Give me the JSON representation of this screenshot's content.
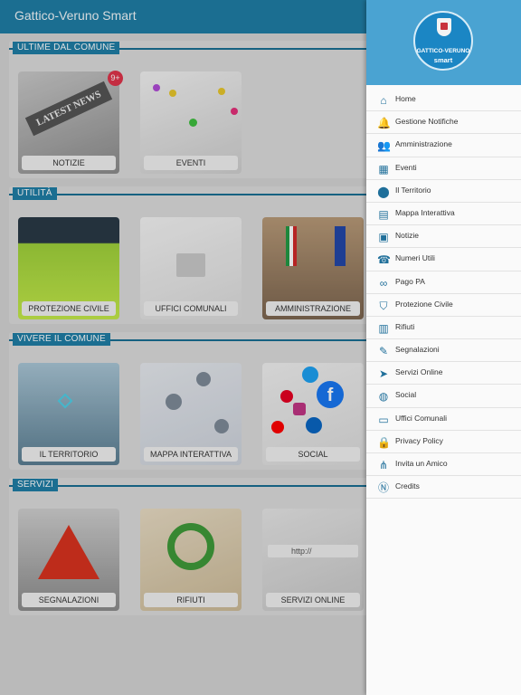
{
  "app": {
    "title": "Gattico-Veruno Smart"
  },
  "sections": [
    {
      "title": "ULTIME DAL COMUNE",
      "tiles": [
        {
          "label": "NOTIZIE",
          "badge": "9+"
        },
        {
          "label": "EVENTI"
        }
      ]
    },
    {
      "title": "UTILITÀ",
      "tiles": [
        {
          "label": "PROTEZIONE CIVILE"
        },
        {
          "label": "UFFICI COMUNALI"
        },
        {
          "label": "AMMINISTRAZIONE"
        }
      ]
    },
    {
      "title": "VIVERE IL COMUNE",
      "tiles": [
        {
          "label": "IL TERRITORIO"
        },
        {
          "label": "MAPPA INTERATTIVA"
        },
        {
          "label": "SOCIAL"
        }
      ]
    },
    {
      "title": "SERVIZI",
      "tiles": [
        {
          "label": "SEGNALAZIONI"
        },
        {
          "label": "RIFIUTI"
        },
        {
          "label": "SERVIZI ONLINE"
        }
      ]
    }
  ],
  "drawer": {
    "logo": {
      "line1": "GATTICO-VERUNO",
      "line2": "smart"
    },
    "items": [
      {
        "label": "Home",
        "icon": "home-icon"
      },
      {
        "label": "Gestione Notifiche",
        "icon": "bell-icon"
      },
      {
        "label": "Amministrazione",
        "icon": "people-icon"
      },
      {
        "label": "Eventi",
        "icon": "calendar-icon"
      },
      {
        "label": "Il Territorio",
        "icon": "location-pin-icon"
      },
      {
        "label": "Mappa Interattiva",
        "icon": "map-icon"
      },
      {
        "label": "Notizie",
        "icon": "news-icon"
      },
      {
        "label": "Numeri Utili",
        "icon": "phone-icon"
      },
      {
        "label": "Pago PA",
        "icon": "handshake-icon"
      },
      {
        "label": "Protezione Civile",
        "icon": "shield-icon"
      },
      {
        "label": "Rifiuti",
        "icon": "trash-icon"
      },
      {
        "label": "Segnalazioni",
        "icon": "edit-icon"
      },
      {
        "label": "Servizi Online",
        "icon": "mouse-pointer-icon"
      },
      {
        "label": "Social",
        "icon": "globe-icon"
      },
      {
        "label": "Uffici Comunali",
        "icon": "briefcase-icon"
      },
      {
        "label": "Privacy Policy",
        "icon": "lock-icon"
      },
      {
        "label": "Invita un Amico",
        "icon": "share-icon"
      },
      {
        "label": "Credits",
        "icon": "nfc-icon"
      }
    ]
  },
  "colors": {
    "primary": "#1f7ea6",
    "drawer_header": "#4aa3d2",
    "badge": "#e0344b"
  }
}
